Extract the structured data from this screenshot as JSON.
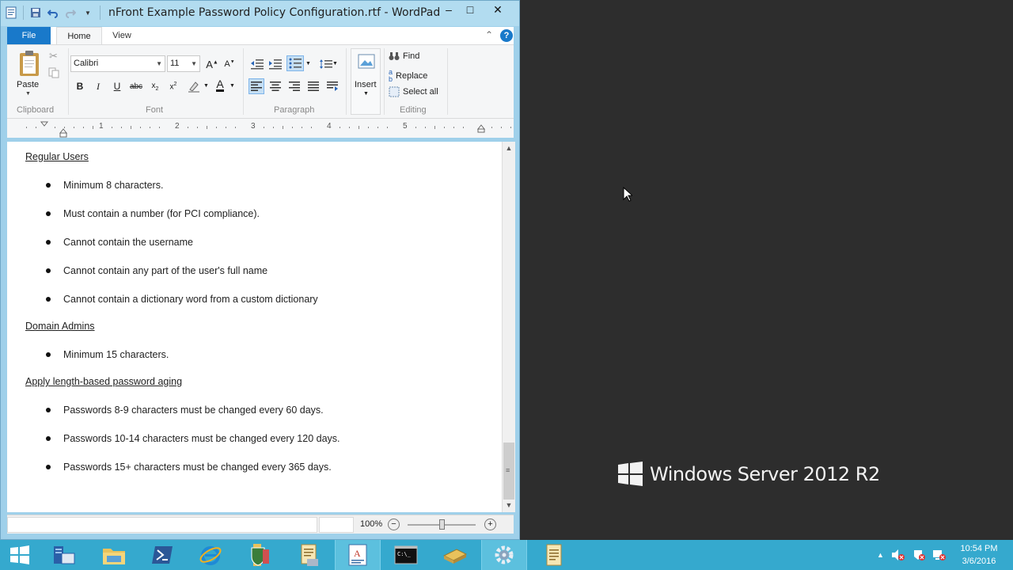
{
  "window": {
    "title": "nFront Example Password Policy Configuration.rtf - WordPad",
    "min_label": "–",
    "max_label": "□",
    "close_label": "✕"
  },
  "ribbon": {
    "tabs": {
      "file": "File",
      "home": "Home",
      "view": "View"
    },
    "clipboard": {
      "paste_label": "Paste",
      "group_label": "Clipboard"
    },
    "font": {
      "family": "Calibri",
      "size": "11",
      "group_label": "Font"
    },
    "paragraph": {
      "group_label": "Paragraph"
    },
    "insert": {
      "label": "Insert"
    },
    "editing": {
      "find": "Find",
      "replace": "Replace",
      "select_all": "Select all",
      "group_label": "Editing"
    }
  },
  "ruler": {
    "numbers": [
      "1",
      "2",
      "3",
      "4",
      "5"
    ]
  },
  "document": {
    "heading_regular": "Regular Users",
    "regular_items": [
      "Minimum 8 characters.",
      "Must contain a number (for PCI compliance).",
      "Cannot contain the username",
      "Cannot contain any part of the user's full name",
      "Cannot contain a dictionary word from a custom dictionary"
    ],
    "heading_admins": "Domain Admins",
    "admin_items": [
      "Minimum 15 characters."
    ],
    "heading_aging": "Apply length-based password aging",
    "aging_items": [
      "Passwords 8-9 characters must be changed every 60 days.",
      "Passwords 10-14 characters must be changed every 120 days.",
      "Passwords 15+ characters must be changed every 365 days."
    ]
  },
  "status": {
    "zoom": "100%",
    "zoom_level": 0.5
  },
  "desktop": {
    "brand": "Windows Server 2012 R2"
  },
  "clock": {
    "time": "10:54 PM",
    "date": "3/6/2016"
  }
}
